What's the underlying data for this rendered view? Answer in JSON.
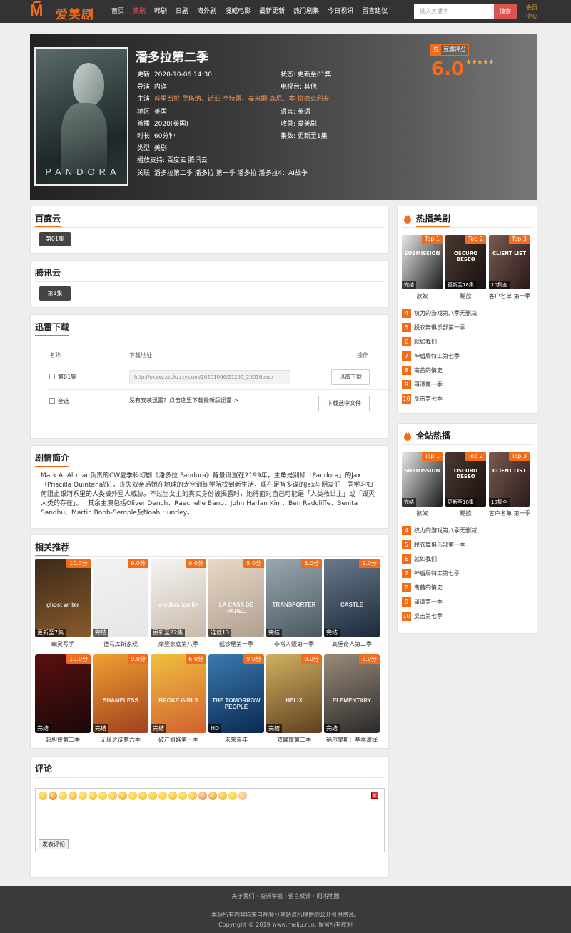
{
  "header": {
    "logo_text": "爱美剧",
    "nav": [
      "首页",
      "美剧",
      "韩剧",
      "日剧",
      "海外剧",
      "漫威电影",
      "最新更新",
      "热门剧集",
      "今日视讯",
      "留言建议"
    ],
    "search_placeholder": "输入关键字",
    "search_button": "搜索",
    "member": "会员中心"
  },
  "show": {
    "title": "潘多拉第二季",
    "poster_text": "PANDORA",
    "left_meta": [
      {
        "label": "更新: ",
        "value": "2020-10-06 14:30"
      },
      {
        "label": "导演: ",
        "value": "内详"
      },
      {
        "label": "主演: ",
        "value": "普里西拉·昆塔纳、诺亚·亨特雷、泰米娜·森尼、本·拉德克利夫"
      },
      {
        "label": "地区: ",
        "value": "美国"
      },
      {
        "label": "首播: ",
        "value": "2020(美国)"
      },
      {
        "label": "时长: ",
        "value": "60分钟"
      },
      {
        "label": "类型: ",
        "value": "美剧"
      },
      {
        "label": "播放支持: ",
        "value": "百度云 腾讯云"
      },
      {
        "label": "关联: ",
        "value": "潘多拉第二季 潘多拉 第一季 潘多拉 潘多拉4：AI战争"
      }
    ],
    "right_meta": [
      {
        "label": "状态: ",
        "value": "更新至01集"
      },
      {
        "label": "电视台: ",
        "value": "其他"
      },
      {
        "label": "语言: ",
        "value": "英语"
      },
      {
        "label": "收录: ",
        "value": "爱美剧"
      },
      {
        "label": "集数: ",
        "value": "更新至1集"
      }
    ],
    "douban_label": "豆瓣评分",
    "douban_icon": "豆",
    "score": "6.0",
    "stars": 4
  },
  "baidu": {
    "title": "百度云",
    "episode": "第01集"
  },
  "tencent": {
    "title": "腾讯云",
    "episode": "第1集"
  },
  "download": {
    "title": "迅雷下载",
    "col_name": "名称",
    "col_url": "下载地址",
    "col_action": "操作",
    "episode": "第01集",
    "url": "http://okzxy.xzokzyzy.com/20201006/21255_23016bad/",
    "thunder_button": "迅雷下载",
    "select_all": "全选",
    "install_hint": "没有安装迅雷？点击这里下载最新版迅雷 >",
    "download_selected": "下载选中文件"
  },
  "synopsis": {
    "title": "剧情简介",
    "text": "Mark A. Altman负责的CW夏季科幻剧《潘多拉 Pandora》背景设置在2199年，主角是别称「Pandora」的Jax（Priscilla Quintana饰），丧失双亲后她在地球的太空训练学院找到新生活，现在足智多谋的Jax与朋友们一同学习如何阻止银河系里的人类被外星人威胁。不过当女主的真实身份被揭露时，她得面对自己可能是「人类救世主」或「毁灭人类的存在」。　 其余主演包括Oliver Dench、Raechelle Bano、John Harlan Kim、Ben Radcliffe、Benita Sandhu、Martin Bobb-Semple及Noah Huntley。"
  },
  "related": {
    "title": "相关推荐",
    "items": [
      {
        "name": "幽灵写手",
        "rating": "10.0分",
        "status": "更新至7集",
        "c1": "#3a2a1a",
        "c2": "#8a5a2a",
        "text": "ghost writer"
      },
      {
        "name": "德马库斯家规",
        "rating": "9.0分",
        "status": "完结",
        "c1": "#f2f2f2",
        "c2": "#e6e6e6",
        "text": ""
      },
      {
        "name": "摩登家庭第八季",
        "rating": "9.0分",
        "status": "更新至22集",
        "c1": "#f5f5f5",
        "c2": "#c9b9a9",
        "text": "modern family"
      },
      {
        "name": "纸钞屋第一季",
        "rating": "5.0分",
        "status": "连载13",
        "c1": "#e8d8c8",
        "c2": "#b0a090",
        "text": "LA CASA DE PAPEL"
      },
      {
        "name": "非常人贩第一季",
        "rating": "5.0分",
        "status": "完结",
        "c1": "#9aa8b0",
        "c2": "#4a5860",
        "text": "TRANSPORTER"
      },
      {
        "name": "高堡奇人第二季",
        "rating": "9.0分",
        "status": "完结",
        "c1": "#6a7a8a",
        "c2": "#1a2a3a",
        "text": "CASTLE"
      },
      {
        "name": "超胆侠第二季",
        "rating": "10.0分",
        "status": "完结",
        "c1": "#5a1010",
        "c2": "#1a0808",
        "text": ""
      },
      {
        "name": "无耻之徒第六季",
        "rating": "9.0分",
        "status": "完结",
        "c1": "#f2a030",
        "c2": "#a04020",
        "text": "SHAMELESS"
      },
      {
        "name": "破产姐妹第一季",
        "rating": "6.0分",
        "status": "完结",
        "c1": "#f0c040",
        "c2": "#d06030",
        "text": "BROKE GIRLS"
      },
      {
        "name": "未来青年",
        "rating": "9.0分",
        "status": "HD",
        "c1": "#3a7ab0",
        "c2": "#0a2a50",
        "text": "THE TOMORROW PEOPLE"
      },
      {
        "name": "双螺旋第二季",
        "rating": "9.0分",
        "status": "完结",
        "c1": "#d0b060",
        "c2": "#604020",
        "text": "HELIX"
      },
      {
        "name": "福尔摩斯：基本演绎",
        "rating": "8.0分",
        "status": "完结",
        "c1": "#9a8a7a",
        "c2": "#2a2a2a",
        "text": "ELEMENTARY"
      }
    ]
  },
  "comments": {
    "title": "评论",
    "submit": "发表评论",
    "close": "×"
  },
  "sidebar_hot": {
    "title": "热播美剧",
    "top": [
      {
        "badge": "Top 1",
        "name": "欲奴",
        "status": "完结",
        "text": "SUBMISSION"
      },
      {
        "badge": "Top 2",
        "name": "黯欲",
        "status": "更新至18集",
        "text": "OSCURO DESEO"
      },
      {
        "badge": "Top 3",
        "name": "客户名单 第一季",
        "status": "10集全",
        "text": "CLIENT LIST"
      }
    ],
    "list": [
      {
        "n": "4",
        "name": "权力的游戏第八季无删减"
      },
      {
        "n": "5",
        "name": "脱衣舞俱乐部第一季"
      },
      {
        "n": "6",
        "name": "就如我们"
      },
      {
        "n": "7",
        "name": "神盾局特工第七季"
      },
      {
        "n": "8",
        "name": "南茜的情史"
      },
      {
        "n": "9",
        "name": "哥谭第一季"
      },
      {
        "n": "10",
        "name": "反击第七季"
      }
    ]
  },
  "sidebar_all": {
    "title": "全站热播",
    "top": [
      {
        "badge": "Top 1",
        "name": "欲奴",
        "status": "完结",
        "text": "SUBMISSION"
      },
      {
        "badge": "Top 2",
        "name": "黯欲",
        "status": "更新至18集",
        "text": "OSCURO DESEO"
      },
      {
        "badge": "Top 3",
        "name": "客户名单 第一季",
        "status": "10集全",
        "text": "CLIENT LIST"
      }
    ],
    "list": [
      {
        "n": "4",
        "name": "权力的游戏第八季无删减"
      },
      {
        "n": "5",
        "name": "脱衣舞俱乐部第一季"
      },
      {
        "n": "6",
        "name": "就如我们"
      },
      {
        "n": "7",
        "name": "神盾局特工第七季"
      },
      {
        "n": "8",
        "name": "南茜的情史"
      },
      {
        "n": "9",
        "name": "哥谭第一季"
      },
      {
        "n": "10",
        "name": "反击第七季"
      }
    ]
  },
  "footer": {
    "links": "关于我们 · 投诉举报 · 留言反馈 · 网站地图",
    "notice": "本站所有内容均来自视频分享站点所提供的公开引用资源。",
    "copyright": "Copyright © 2019 www.meiju.run. 保留所有权利"
  }
}
